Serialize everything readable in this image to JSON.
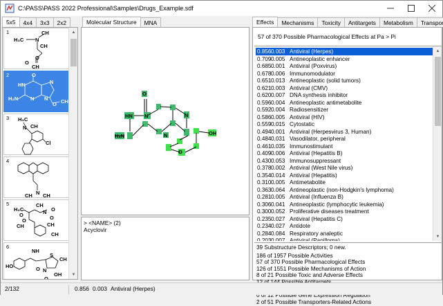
{
  "window": {
    "title": "C:\\PASS\\PASS 2022 Professional\\Samples\\Drugs_Example.sdf"
  },
  "thumb_tabs": [
    "5x5",
    "4x4",
    "3x3",
    "2x2"
  ],
  "view_tabs": [
    "Molecular Structure",
    "MNA"
  ],
  "right_tabs": [
    "Effects",
    "Mechanisms",
    "Toxicity",
    "Antitargets",
    "Metabolism",
    "Transporters"
  ],
  "thumbnails": [
    {
      "index": "1",
      "atoms": [
        "CH",
        "H₃C",
        "N",
        "CH",
        "O",
        "O",
        "CH"
      ]
    },
    {
      "index": "2",
      "atoms": [
        "O",
        "HN",
        "N",
        "H₂N",
        "N",
        "N",
        "O",
        "CH"
      ]
    },
    {
      "index": "3",
      "atoms": [
        "H₃C",
        "N",
        "CH",
        "Cl"
      ]
    },
    {
      "index": "4",
      "atoms": [
        "N",
        "CH",
        "CH"
      ]
    },
    {
      "index": "5",
      "atoms": [
        "H₃C",
        "CH",
        "O",
        "N",
        "O",
        "O",
        "O",
        "CH",
        "CH",
        "CH"
      ]
    },
    {
      "index": "6",
      "atoms": [
        "NH",
        "HO",
        "S",
        "CH",
        "O",
        "OH",
        "N",
        "O"
      ]
    }
  ],
  "molecule": {
    "atoms": [
      "O",
      "HN",
      "N",
      "H₂N",
      "N",
      "N",
      "O",
      "OH"
    ]
  },
  "info": {
    "name_tag": ">  <NAME> (2)",
    "name_value": "Acyclovir"
  },
  "effects": {
    "header": "57 of 370 Possible Pharmacological Effects at Pa > Pi",
    "rows": [
      {
        "pa": "0.856",
        "pi": "0.003",
        "name": "Antiviral (Herpes)"
      },
      {
        "pa": "0.709",
        "pi": "0.005",
        "name": "Antineoplastic enhancer"
      },
      {
        "pa": "0.685",
        "pi": "0.001",
        "name": "Antiviral (Poxvirus)"
      },
      {
        "pa": "0.678",
        "pi": "0.006",
        "name": "Immunomodulator"
      },
      {
        "pa": "0.651",
        "pi": "0.013",
        "name": "Antineoplastic (solid tumors)"
      },
      {
        "pa": "0.621",
        "pi": "0.003",
        "name": "Antiviral (CMV)"
      },
      {
        "pa": "0.620",
        "pi": "0.007",
        "name": "DNA synthesis inhibitor"
      },
      {
        "pa": "0.596",
        "pi": "0.004",
        "name": "Antineoplastic antimetabolite"
      },
      {
        "pa": "0.592",
        "pi": "0.004",
        "name": "Radiosensitizer"
      },
      {
        "pa": "0.586",
        "pi": "0.005",
        "name": "Antiviral (HIV)"
      },
      {
        "pa": "0.559",
        "pi": "0.015",
        "name": "Cytostatic"
      },
      {
        "pa": "0.494",
        "pi": "0.001",
        "name": "Antiviral (Herpesvirus 3, Human)"
      },
      {
        "pa": "0.484",
        "pi": "0.031",
        "name": "Vasodilator, peripheral"
      },
      {
        "pa": "0.461",
        "pi": "0.035",
        "name": "Immunostimulant"
      },
      {
        "pa": "0.409",
        "pi": "0.006",
        "name": "Antiviral (Hepatitis B)"
      },
      {
        "pa": "0.430",
        "pi": "0.053",
        "name": "Immunosuppressant"
      },
      {
        "pa": "0.378",
        "pi": "0.002",
        "name": "Antiviral (West Nile virus)"
      },
      {
        "pa": "0.354",
        "pi": "0.014",
        "name": "Antiviral (Hepatitis)"
      },
      {
        "pa": "0.310",
        "pi": "0.005",
        "name": "Antimetabolite"
      },
      {
        "pa": "0.363",
        "pi": "0.064",
        "name": "Antineoplastic (non-Hodgkin's lymphoma)"
      },
      {
        "pa": "0.281",
        "pi": "0.005",
        "name": "Antiviral (Influenza B)"
      },
      {
        "pa": "0.306",
        "pi": "0.041",
        "name": "Antineoplastic (lymphocytic leukemia)"
      },
      {
        "pa": "0.300",
        "pi": "0.052",
        "name": "Proliferative diseases treatment"
      },
      {
        "pa": "0.235",
        "pi": "0.027",
        "name": "Antiviral (Hepatitis C)"
      },
      {
        "pa": "0.234",
        "pi": "0.027",
        "name": "Antidote"
      },
      {
        "pa": "0.284",
        "pi": "0.084",
        "name": "Respiratory analeptic"
      },
      {
        "pa": "0.203",
        "pi": "0.007",
        "name": "Antiviral (Papilloma)"
      }
    ],
    "selected_index": 0
  },
  "summary": [
    "39  Substructure Descriptors;  0  new.",
    "186 of 1957 Possible Activities",
    "57 of 370 Possible Pharmacological Effects",
    "126 of 1551 Possible Mechanisms of Action",
    "8 of 21 Possible Toxic and Adverse Effects",
    "12 of 144 Possible Antitargets",
    "7 of 48 Possible Metabolism-Related Actions",
    "0 of 12 Possible Gene Expression Regulation",
    "2 of 51 Possible Transporters-Related Actions"
  ],
  "status": {
    "record": "2/132",
    "pa": "0.856",
    "pi": "0.003",
    "activity": "Antiviral (Herpes)"
  },
  "colors": {
    "selection": "#0a5fd6",
    "thumb_selection": "#3c84e6",
    "highlight_atom": "#3fb96b",
    "highlight_green": "#3fe04a"
  }
}
